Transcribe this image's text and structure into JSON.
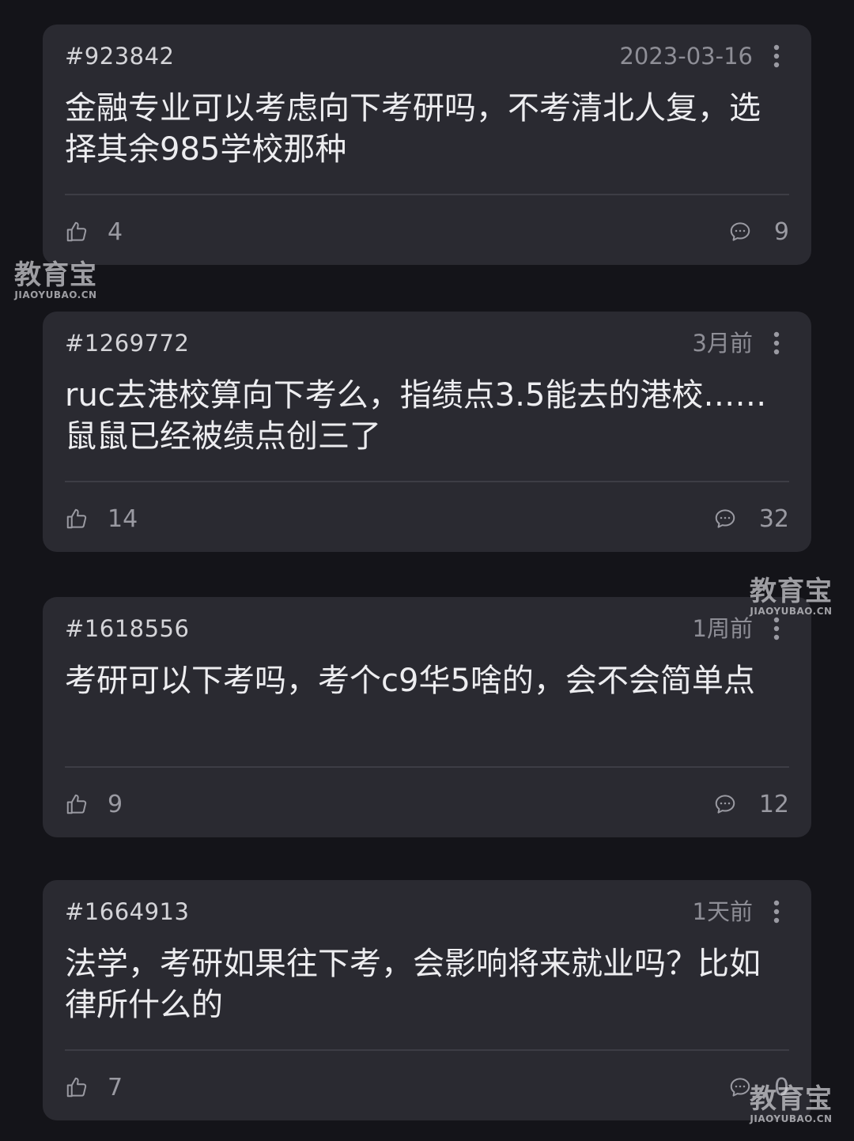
{
  "posts": [
    {
      "id": "#923842",
      "time": "2023-03-16",
      "body": "金融专业可以考虑向下考研吗，不考清北人复，选择其余985学校那种",
      "likes": "4",
      "comments": "9"
    },
    {
      "id": "#1269772",
      "time": "3月前",
      "body": "ruc去港校算向下考么，指绩点3.5能去的港校……鼠鼠已经被绩点创三了",
      "likes": "14",
      "comments": "32"
    },
    {
      "id": "#1618556",
      "time": "1周前",
      "body": "考研可以下考吗，考个c9华5啥的，会不会简单点",
      "likes": "9",
      "comments": "12"
    },
    {
      "id": "#1664913",
      "time": "1天前",
      "body": "法学，考研如果往下考，会影响将来就业吗？比如律所什么的",
      "likes": "7",
      "comments": "0"
    }
  ],
  "watermark": {
    "main": "教育宝",
    "sub": "JIAOYUBAO.CN"
  },
  "icons": {
    "more": "more-vertical-icon",
    "like": "thumbs-up-icon",
    "comment": "chat-bubble-icon"
  },
  "colors": {
    "background": "#141419",
    "card": "#2a2a31",
    "text_primary": "#ededf0",
    "text_secondary": "#8e8e96"
  }
}
